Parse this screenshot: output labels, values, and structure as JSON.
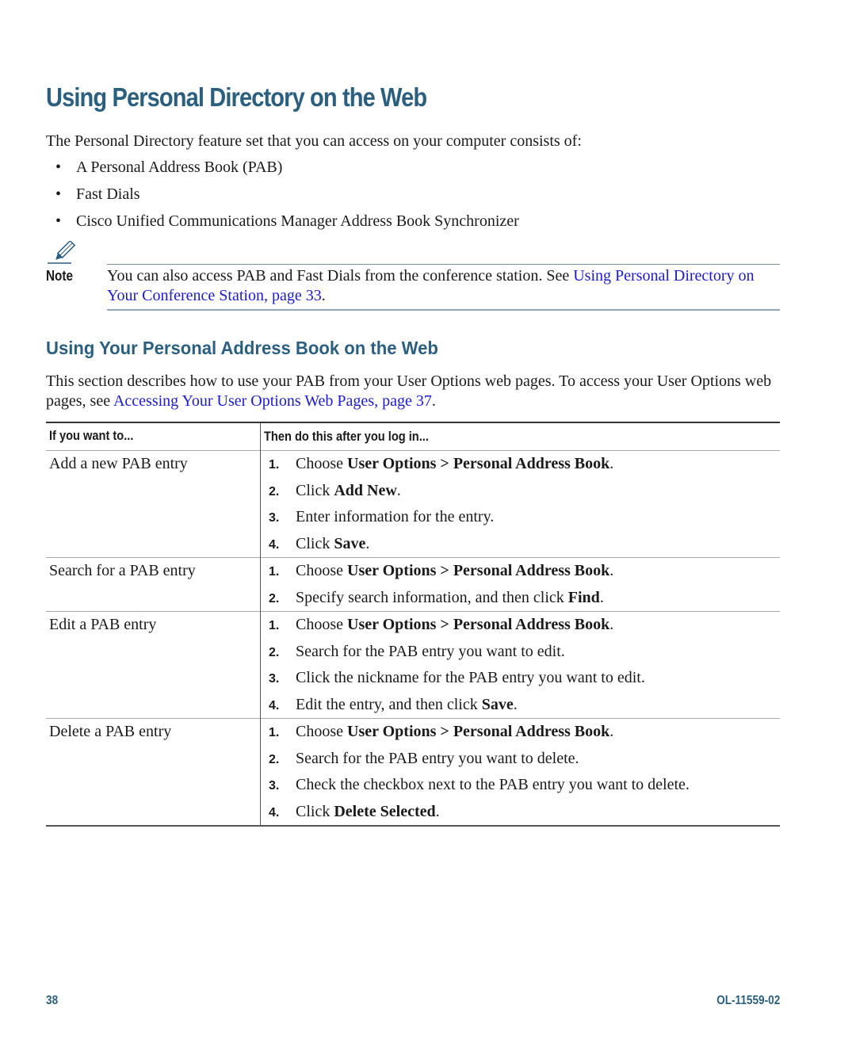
{
  "title": "Using Personal Directory on the Web",
  "intro": "The Personal Directory feature set that you can access on your computer consists of:",
  "bullets": [
    "A Personal Address Book (PAB)",
    "Fast Dials",
    "Cisco Unified Communications Manager Address Book Synchronizer"
  ],
  "note": {
    "label": "Note",
    "icon": "pencil-icon",
    "text": "You can also access PAB and Fast Dials from the conference station. See ",
    "link": "Using Personal Directory on Your Conference Station, page 33",
    "end": "."
  },
  "section": {
    "title": "Using Your Personal Address Book on the Web",
    "text": "This section describes how to use your PAB from your User Options web pages. To access your User Options web pages, see ",
    "link": "Accessing Your User Options Web Pages, page 37",
    "end": "."
  },
  "table": {
    "headers": [
      "If you want to...",
      "Then do this after you log in..."
    ],
    "rows": [
      {
        "task": "Add a new PAB entry",
        "steps": [
          {
            "num": "1.",
            "pre": "Choose ",
            "bold": "User Options > Personal Address Book",
            "post": "."
          },
          {
            "num": "2.",
            "pre": "Click ",
            "bold": "Add New",
            "post": "."
          },
          {
            "num": "3.",
            "pre": "Enter information for the entry.",
            "bold": "",
            "post": ""
          },
          {
            "num": "4.",
            "pre": "Click ",
            "bold": "Save",
            "post": "."
          }
        ]
      },
      {
        "task": "Search for a PAB entry",
        "steps": [
          {
            "num": "1.",
            "pre": "Choose ",
            "bold": "User Options > Personal Address Book",
            "post": "."
          },
          {
            "num": "2.",
            "pre": "Specify search information, and then click ",
            "bold": "Find",
            "post": "."
          }
        ]
      },
      {
        "task": "Edit a PAB entry",
        "steps": [
          {
            "num": "1.",
            "pre": "Choose ",
            "bold": "User Options > Personal Address Book",
            "post": "."
          },
          {
            "num": "2.",
            "pre": "Search for the PAB entry you want to edit.",
            "bold": "",
            "post": ""
          },
          {
            "num": "3.",
            "pre": "Click the nickname for the PAB entry you want to edit.",
            "bold": "",
            "post": ""
          },
          {
            "num": "4.",
            "pre": "Edit the entry, and then click ",
            "bold": "Save",
            "post": "."
          }
        ]
      },
      {
        "task": "Delete a PAB entry",
        "steps": [
          {
            "num": "1.",
            "pre": "Choose ",
            "bold": "User Options > Personal Address Book",
            "post": "."
          },
          {
            "num": "2.",
            "pre": "Search for the PAB entry you want to delete.",
            "bold": "",
            "post": ""
          },
          {
            "num": "3.",
            "pre": "Check the checkbox next to the PAB entry you want to delete.",
            "bold": "",
            "post": ""
          },
          {
            "num": "4.",
            "pre": "Click ",
            "bold": "Delete Selected",
            "post": "."
          }
        ]
      }
    ]
  },
  "footer": {
    "page_number": "38",
    "doc_id": "OL-11559-02"
  },
  "colors": {
    "heading": "#2b5f80",
    "link": "#1c1ccc"
  }
}
